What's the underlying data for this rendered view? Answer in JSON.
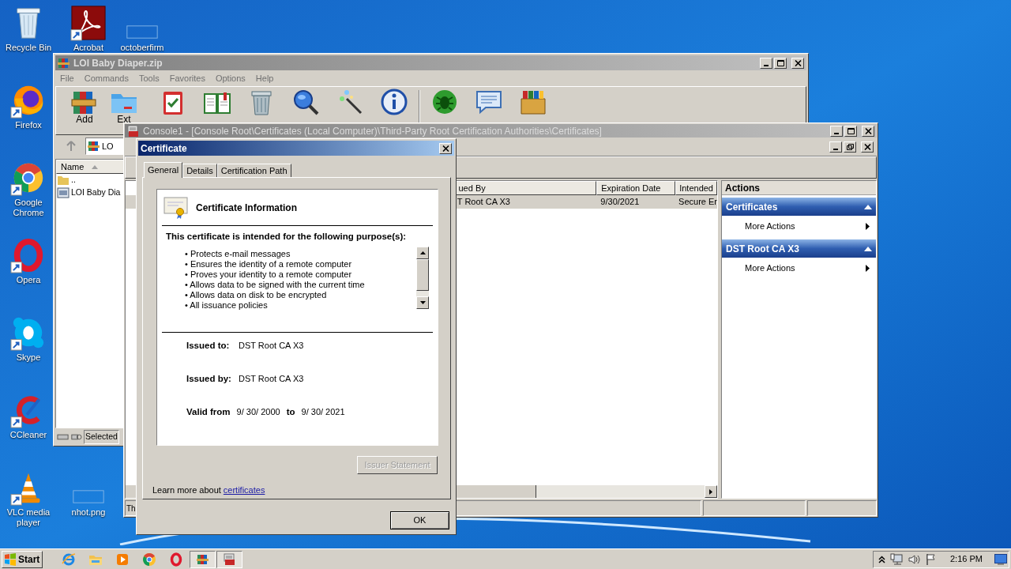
{
  "desktop_icons": [
    {
      "label": "Recycle Bin",
      "kind": "recycle_bin",
      "shortcut": false
    },
    {
      "label": "Acrobat",
      "kind": "acrobat",
      "shortcut": true
    },
    {
      "label": "octoberfirm",
      "kind": "blank",
      "shortcut": false
    },
    {
      "label": "Firefox",
      "kind": "firefox",
      "shortcut": true
    },
    {
      "label": "Google Chrome",
      "kind": "chrome",
      "shortcut": true
    },
    {
      "label": "Opera",
      "kind": "opera",
      "shortcut": true
    },
    {
      "label": "Skype",
      "kind": "skype",
      "shortcut": true
    },
    {
      "label": "CCleaner",
      "kind": "ccleaner",
      "shortcut": true
    },
    {
      "label": "VLC media player",
      "kind": "vlc",
      "shortcut": true
    },
    {
      "label": "nhot.png",
      "kind": "blank",
      "shortcut": false
    }
  ],
  "archive_window": {
    "title": "LOI Baby Diaper.zip",
    "active": false,
    "menu": [
      "File",
      "Commands",
      "Tools",
      "Favorites",
      "Options",
      "Help"
    ],
    "toolbar": [
      {
        "kind": "add",
        "label": "Add"
      },
      {
        "kind": "extract",
        "label": "Ext"
      },
      {
        "kind": "test"
      },
      {
        "kind": "view"
      },
      {
        "kind": "delete"
      },
      {
        "kind": "find"
      },
      {
        "kind": "wizard"
      },
      {
        "kind": "info"
      },
      {
        "kind": "separator"
      },
      {
        "kind": "virus"
      },
      {
        "kind": "comment"
      },
      {
        "kind": "sfx"
      }
    ],
    "address": "LO",
    "columns": [
      "Name"
    ],
    "files": [
      {
        "name": "..",
        "kind": "parent"
      },
      {
        "name": "LOI Baby Dia",
        "kind": "file"
      }
    ],
    "status": "Selected"
  },
  "console_window": {
    "title": "Console1 - [Console Root\\Certificates (Local Computer)\\Third-Party Root Certification Authorities\\Certificates]",
    "active": false,
    "columns": [
      "ued By",
      "Expiration Date",
      "Intended"
    ],
    "rows": [
      {
        "cells": [
          "T Root CA X3",
          "9/30/2021",
          "Secure Er"
        ],
        "selected": true
      }
    ],
    "actions": {
      "title": "Actions",
      "sections": [
        {
          "title": "Certificates",
          "expanded": true,
          "items": [
            "More Actions"
          ]
        },
        {
          "title": "DST Root CA X3",
          "expanded": true,
          "items": [
            "More Actions"
          ]
        }
      ]
    },
    "status": "Th"
  },
  "certificate_dialog": {
    "title": "Certificate",
    "active": true,
    "tabs": [
      {
        "label": "General",
        "selected": true
      },
      {
        "label": "Details",
        "selected": false
      },
      {
        "label": "Certification Path",
        "selected": false
      }
    ],
    "heading": "Certificate Information",
    "purpose_heading": "This certificate is intended for the following purpose(s):",
    "purposes": [
      "• Protects e-mail messages",
      "• Ensures the identity of a remote computer",
      "• Proves your identity to a remote computer",
      "• Allows data to be signed with the current time",
      "• Allows data on disk to be encrypted",
      "• All issuance policies"
    ],
    "fields": [
      {
        "label": "Issued to:",
        "value": "DST Root CA X3"
      },
      {
        "label": "Issued by:",
        "value": "DST Root CA X3"
      }
    ],
    "validity": {
      "label": "Valid from",
      "from": "9/ 30/ 2000",
      "to_label": "to",
      "to": "9/ 30/ 2021"
    },
    "issuer_button": {
      "label": "Issuer Statement",
      "disabled": true
    },
    "learn_more": {
      "text": "Learn more about",
      "link": "certificates"
    },
    "ok_button": "OK"
  },
  "taskbar": {
    "start": "Start",
    "apps": [
      {
        "kind": "ie",
        "selected": false
      },
      {
        "kind": "explorer",
        "selected": false
      },
      {
        "kind": "media_player",
        "selected": false
      },
      {
        "kind": "chrome",
        "selected": false
      },
      {
        "kind": "opera",
        "selected": false
      },
      {
        "kind": "winrar",
        "selected": true
      },
      {
        "kind": "console",
        "selected": true
      }
    ],
    "clock": "2:16 PM"
  }
}
